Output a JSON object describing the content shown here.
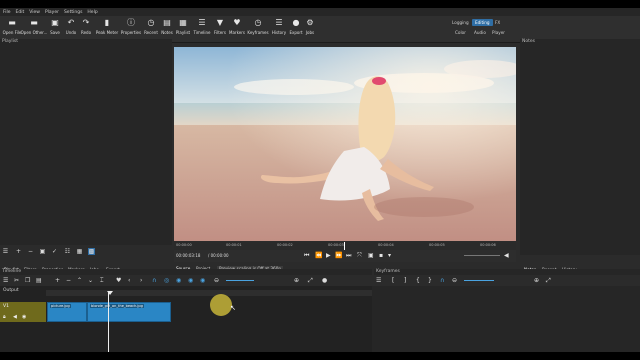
{
  "menu": [
    "File",
    "Edit",
    "View",
    "Player",
    "Settings",
    "Help"
  ],
  "toolbar": [
    {
      "label": "Open File",
      "icon": "folder-icon",
      "glyph": "▬"
    },
    {
      "label": "Open Other...",
      "icon": "folder-other-icon",
      "glyph": "▬"
    },
    {
      "label": "Save",
      "icon": "save-icon",
      "glyph": "▣"
    },
    {
      "label": "Undo",
      "icon": "undo-icon",
      "glyph": "↶"
    },
    {
      "label": "Redo",
      "icon": "redo-icon",
      "glyph": "↷"
    },
    {
      "label": "Peak Meter",
      "icon": "peak-meter-icon",
      "glyph": "▮"
    },
    {
      "label": "Properties",
      "icon": "properties-icon",
      "glyph": "ⓘ"
    },
    {
      "label": "Recent",
      "icon": "recent-icon",
      "glyph": "◷"
    },
    {
      "label": "Notes",
      "icon": "notes-icon",
      "glyph": "▤"
    },
    {
      "label": "Playlist",
      "icon": "playlist-icon",
      "glyph": "▦"
    },
    {
      "label": "Timeline",
      "icon": "timeline-icon",
      "glyph": "☰"
    },
    {
      "label": "Filters",
      "icon": "filters-icon",
      "glyph": "▼"
    },
    {
      "label": "Markers",
      "icon": "markers-icon",
      "glyph": "♥"
    },
    {
      "label": "Keyframes",
      "icon": "keyframes-icon",
      "glyph": "◷"
    },
    {
      "label": "History",
      "icon": "history-icon",
      "glyph": "☰"
    },
    {
      "label": "Export",
      "icon": "export-icon",
      "glyph": "●"
    },
    {
      "label": "Jobs",
      "icon": "jobs-icon",
      "glyph": "⚙"
    }
  ],
  "workspaces": {
    "logging": "Logging",
    "editing": "Editing",
    "fx": "FX",
    "color": "Color",
    "audio": "Audio",
    "player": "Player"
  },
  "panels": {
    "playlist": "Playlist",
    "notes": "Notes",
    "timeline": "Timeline",
    "keyframes": "Keyframes"
  },
  "ruler": [
    "00:00:00",
    "00:00:01",
    "00:00:02",
    "00:00:03",
    "00:00:04",
    "00:00:05",
    "00:00:06"
  ],
  "transport": {
    "position": "00:00:03:18",
    "duration": "/ 00:00:00",
    "scaling": "Preview scaling is Off at 360p"
  },
  "viewer_tabs": {
    "source": "Source",
    "project": "Project"
  },
  "left_tabs": [
    "Playlist",
    "Filters",
    "Properties",
    "Markers",
    "Jobs",
    "Export"
  ],
  "right_tabs": [
    "Notes",
    "Recent",
    "History"
  ],
  "timeline": {
    "output": "Output",
    "track": "V1",
    "clips": [
      "picture.jpg",
      "blonde_girl_on_the_beach.jpg"
    ]
  },
  "colors": {
    "accent": "#2f6ea5",
    "clip": "#2a86c5",
    "track": "#6f6a1c"
  }
}
